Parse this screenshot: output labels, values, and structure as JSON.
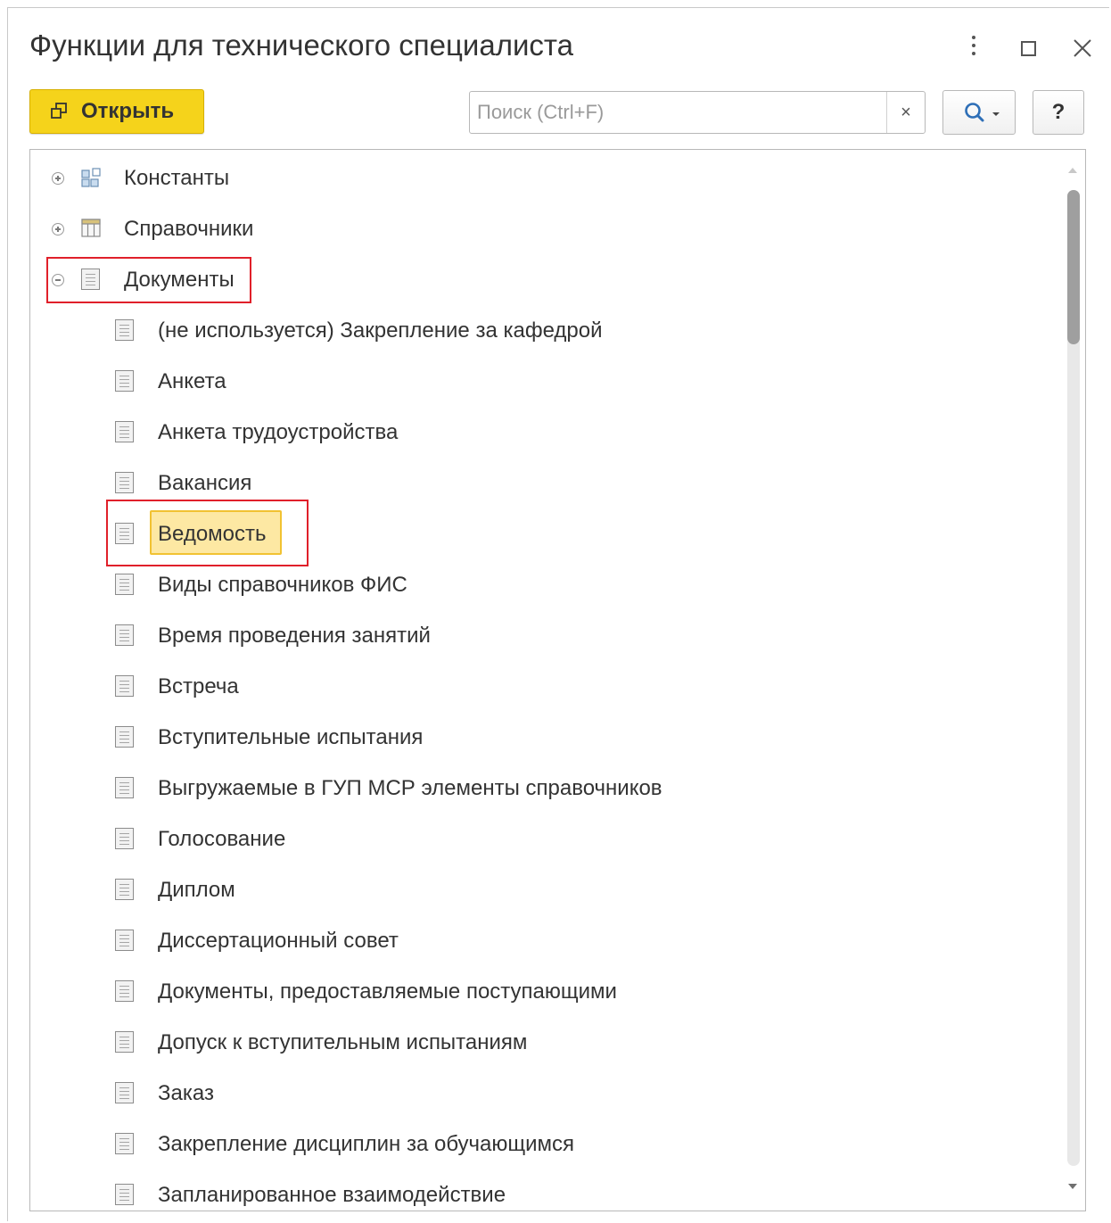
{
  "window": {
    "title": "Функции для технического специалиста"
  },
  "toolbar": {
    "open_label": "Открыть",
    "search_placeholder": "Поиск (Ctrl+F)",
    "search_value": "",
    "clear_symbol": "×",
    "help_label": "?"
  },
  "tree": {
    "items": [
      {
        "label": "Константы",
        "level": 0,
        "icon": "constants-icon",
        "expander": "collapsed"
      },
      {
        "label": "Справочники",
        "level": 0,
        "icon": "catalog-icon",
        "expander": "collapsed"
      },
      {
        "label": "Документы",
        "level": 0,
        "icon": "document-icon",
        "expander": "expanded"
      },
      {
        "label": "(не используется) Закрепление за кафедрой",
        "level": 1,
        "icon": "document-icon"
      },
      {
        "label": "Анкета",
        "level": 1,
        "icon": "document-icon"
      },
      {
        "label": "Анкета трудоустройства",
        "level": 1,
        "icon": "document-icon"
      },
      {
        "label": "Вакансия",
        "level": 1,
        "icon": "document-icon"
      },
      {
        "label": "Ведомость",
        "level": 1,
        "icon": "document-icon",
        "selected": true
      },
      {
        "label": "Виды справочников ФИС",
        "level": 1,
        "icon": "document-icon"
      },
      {
        "label": "Время проведения занятий",
        "level": 1,
        "icon": "document-icon"
      },
      {
        "label": "Встреча",
        "level": 1,
        "icon": "document-icon"
      },
      {
        "label": "Вступительные испытания",
        "level": 1,
        "icon": "document-icon"
      },
      {
        "label": "Выгружаемые в ГУП МСР элементы справочников",
        "level": 1,
        "icon": "document-icon"
      },
      {
        "label": "Голосование",
        "level": 1,
        "icon": "document-icon"
      },
      {
        "label": "Диплом",
        "level": 1,
        "icon": "document-icon"
      },
      {
        "label": "Диссертационный совет",
        "level": 1,
        "icon": "document-icon"
      },
      {
        "label": "Документы, предоставляемые поступающими",
        "level": 1,
        "icon": "document-icon"
      },
      {
        "label": "Допуск к вступительным испытаниям",
        "level": 1,
        "icon": "document-icon"
      },
      {
        "label": "Заказ",
        "level": 1,
        "icon": "document-icon"
      },
      {
        "label": "Закрепление дисциплин за обучающимся",
        "level": 1,
        "icon": "document-icon"
      },
      {
        "label": "Запланированное взаимодействие",
        "level": 1,
        "icon": "document-icon"
      }
    ]
  },
  "colors": {
    "open_button": "#f5d31b",
    "selection_fill": "#fde8a3",
    "selection_border": "#f1c232",
    "annotation": "#e0202a"
  }
}
